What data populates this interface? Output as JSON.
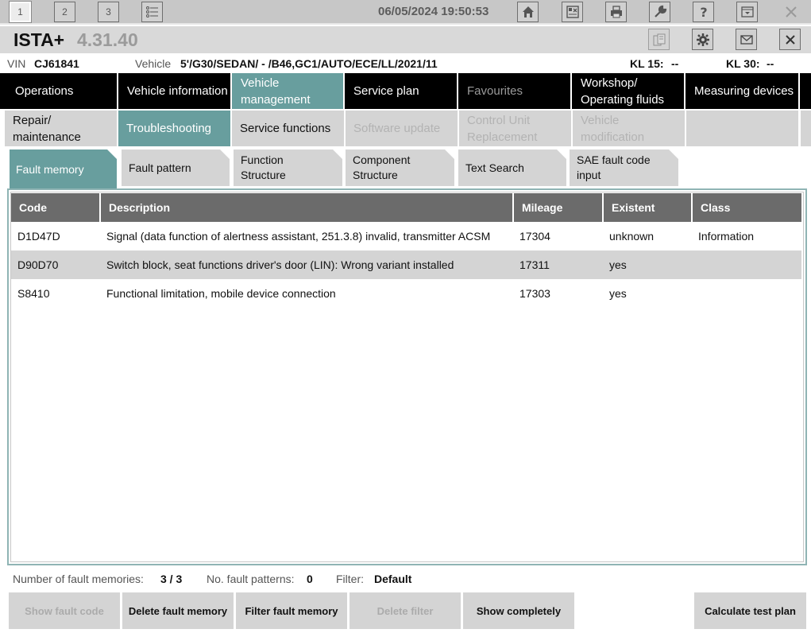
{
  "topbar": {
    "window_tabs": [
      "1",
      "2",
      "3"
    ],
    "datetime": "06/05/2024 19:50:53",
    "icons": [
      "list-icon",
      "home-icon",
      "id-card-icon",
      "printer-icon",
      "wrench-icon",
      "help-icon",
      "minimize-icon",
      "close-icon"
    ]
  },
  "titlebar": {
    "app_name": "ISTA+",
    "version": "4.31.40"
  },
  "vehicle": {
    "vin_label": "VIN",
    "vin": "CJ61841",
    "vehicle_label": "Vehicle",
    "vehicle_value": "5'/G30/SEDAN/ - /B46,GC1/AUTO/ECE/LL/2021/11",
    "kl15_label": "KL 15:",
    "kl15_value": "--",
    "kl30_label": "KL 30:",
    "kl30_value": "--"
  },
  "main_nav": [
    {
      "label": "Operations"
    },
    {
      "label": "Vehicle information"
    },
    {
      "label": "Vehicle\nmanagement"
    },
    {
      "label": "Service plan"
    },
    {
      "label": "Favourites"
    },
    {
      "label": "Workshop/\nOperating fluids"
    },
    {
      "label": "Measuring devices"
    }
  ],
  "sub_nav": [
    {
      "label": "Repair/\nmaintenance"
    },
    {
      "label": "Troubleshooting"
    },
    {
      "label": "Service functions"
    },
    {
      "label": "Software update"
    },
    {
      "label": "Control Unit\nReplacement"
    },
    {
      "label": "Vehicle\nmodification"
    }
  ],
  "tabs": [
    {
      "label": "Fault memory"
    },
    {
      "label": "Fault pattern"
    },
    {
      "label": "Function\nStructure"
    },
    {
      "label": "Component\nStructure"
    },
    {
      "label": "Text Search"
    },
    {
      "label": "SAE fault code\ninput"
    }
  ],
  "table": {
    "columns": [
      "Code",
      "Description",
      "Mileage",
      "Existent",
      "Class"
    ],
    "rows": [
      [
        "D1D47D",
        "Signal (data function of alertness assistant, 251.3.8) invalid, transmitter ACSM",
        "17304",
        "unknown",
        "Information"
      ],
      [
        "D90D70",
        "Switch block, seat functions driver's door (LIN): Wrong variant installed",
        "17311",
        "yes",
        ""
      ],
      [
        "S8410",
        "Functional limitation, mobile device connection",
        "17303",
        "yes",
        ""
      ]
    ]
  },
  "status": {
    "fault_mem_label": "Number of fault memories:",
    "fault_mem_value": "3 / 3",
    "patterns_label": "No. fault patterns:",
    "patterns_value": "0",
    "filter_label": "Filter:",
    "filter_value": "Default"
  },
  "buttons": {
    "show_fault_code": "Show fault code",
    "delete_fault_memory": "Delete fault memory",
    "filter_fault_memory": "Filter fault memory",
    "delete_filter": "Delete filter",
    "show_completely": "Show completely",
    "calculate_test_plan": "Calculate test plan"
  },
  "colors": {
    "accent": "#689e9e",
    "header": "#6b6b6b",
    "nav": "#000000"
  }
}
